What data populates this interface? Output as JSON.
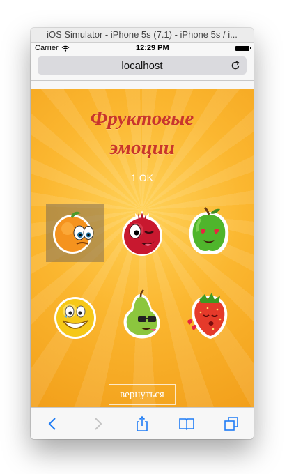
{
  "simulator": {
    "title": "iOS Simulator - iPhone 5s (7.1) - iPhone 5s / i..."
  },
  "status_bar": {
    "carrier": "Carrier",
    "time": "12:29 PM",
    "wifi_icon": "wifi-icon",
    "battery_icon": "battery-icon"
  },
  "browser": {
    "url": "localhost",
    "reload_icon": "reload-icon"
  },
  "game": {
    "title_line1": "Фруктовые",
    "title_line2": "эмоции",
    "score": "1 OK",
    "back_label": "вернуться",
    "title_color": "#c9362c",
    "background_color": "#fbb730",
    "tiles": [
      {
        "name": "orange-worried",
        "selected": true
      },
      {
        "name": "pomegranate-winking",
        "selected": false
      },
      {
        "name": "apple-heart-eyes",
        "selected": false
      },
      {
        "name": "smiley-laughing",
        "selected": false
      },
      {
        "name": "pear-sunglasses",
        "selected": false
      },
      {
        "name": "strawberry-kissing",
        "selected": false
      }
    ]
  },
  "toolbar": {
    "items": [
      "back-arrow-icon",
      "forward-arrow-icon",
      "share-icon",
      "bookmarks-icon",
      "tabs-icon"
    ]
  }
}
